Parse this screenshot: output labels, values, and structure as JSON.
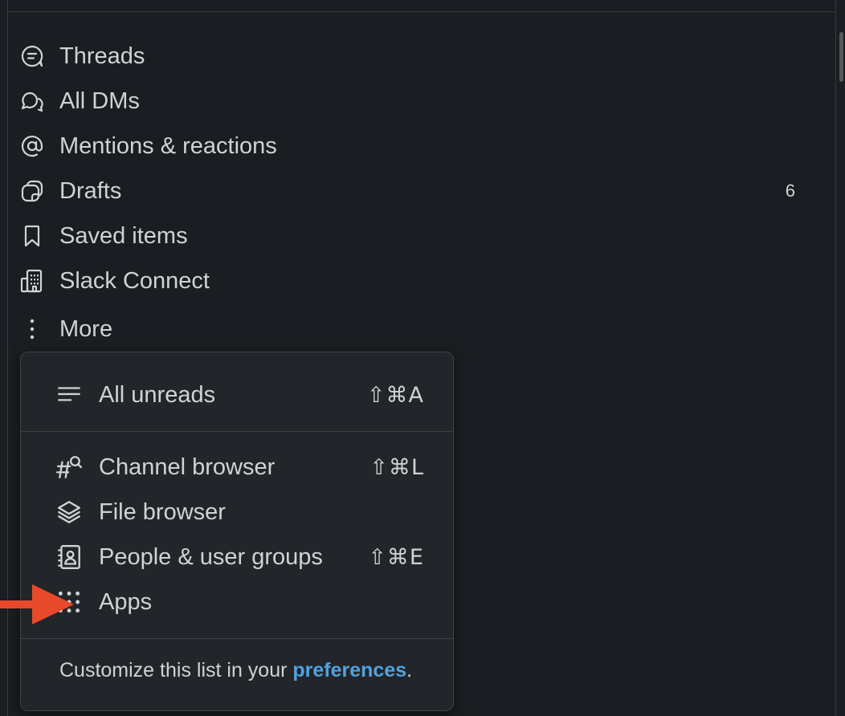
{
  "sidebar": {
    "items": [
      {
        "label": "Threads",
        "icon": "threads-icon",
        "count": ""
      },
      {
        "label": "All DMs",
        "icon": "dms-icon",
        "count": ""
      },
      {
        "label": "Mentions & reactions",
        "icon": "at-sign-icon",
        "count": ""
      },
      {
        "label": "Drafts",
        "icon": "drafts-icon",
        "count": "6"
      },
      {
        "label": "Saved items",
        "icon": "bookmark-icon",
        "count": ""
      },
      {
        "label": "Slack Connect",
        "icon": "building-icon",
        "count": ""
      },
      {
        "label": "More",
        "icon": "vertical-dots-icon",
        "count": ""
      }
    ]
  },
  "more_menu": {
    "items": [
      {
        "label": "All unreads",
        "icon": "lines-icon",
        "shortcut": "⇧⌘A"
      },
      {
        "label": "Channel browser",
        "icon": "channel-search-icon",
        "shortcut": "⇧⌘L"
      },
      {
        "label": "File browser",
        "icon": "layers-icon",
        "shortcut": ""
      },
      {
        "label": "People & user groups",
        "icon": "contact-book-icon",
        "shortcut": "⇧⌘E"
      },
      {
        "label": "Apps",
        "icon": "apps-grid-icon",
        "shortcut": ""
      }
    ],
    "footer_prefix": "Customize this list in your ",
    "footer_link": "preferences",
    "footer_suffix": "."
  },
  "colors": {
    "background": "#1a1d21",
    "menu_background": "#222529",
    "text": "#d1d2d3",
    "link": "#4fa3dd",
    "annotation_arrow": "#e8492a"
  }
}
